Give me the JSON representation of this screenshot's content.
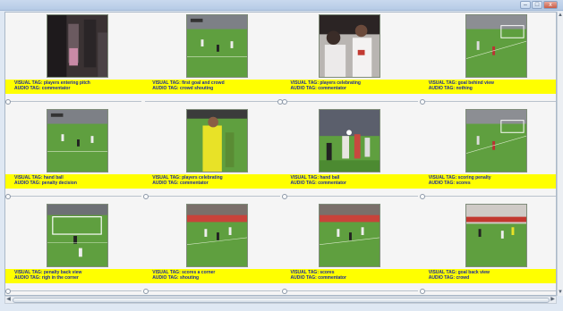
{
  "window": {
    "buttons": [
      {
        "name": "minimize-button",
        "glyph": "–"
      },
      {
        "name": "maximize-button",
        "glyph": "□"
      },
      {
        "name": "close-button",
        "glyph": "x"
      }
    ]
  },
  "clips": [
    {
      "visual": "VISUAL TAG: players entering pitch",
      "audio": "AUDIO TAG: commentator",
      "scene": "tunnel"
    },
    {
      "visual": "VISUAL TAG: first goal and crowd",
      "audio": "AUDIO TAG: crowd shouting",
      "scene": "pitch"
    },
    {
      "visual": "VISUAL TAG: players celebrating",
      "audio": "AUDIO TAG: commentator",
      "scene": "celebrate"
    },
    {
      "visual": "VISUAL TAG: goal behind view",
      "audio": "AUDIO TAG: nothing",
      "scene": "goalview"
    },
    {
      "visual": "VISUAL TAG: hand ball",
      "audio": "AUDIO TAG: penalty decision",
      "scene": "pitch"
    },
    {
      "visual": "VISUAL TAG: players celebrating",
      "audio": "AUDIO TAG: commentator",
      "scene": "referee"
    },
    {
      "visual": "VISUAL TAG: hand ball",
      "audio": "AUDIO TAG: commentator",
      "scene": "handball"
    },
    {
      "visual": "VISUAL TAG: scoring penalty",
      "audio": "AUDIO TAG: scores",
      "scene": "goalview"
    },
    {
      "visual": "VISUAL TAG: penalty back view",
      "audio": "AUDIO TAG: righ in the corner",
      "scene": "penalty"
    },
    {
      "visual": "VISUAL TAG: scores a corner",
      "audio": "AUDIO TAG: shouting",
      "scene": "corner"
    },
    {
      "visual": "VISUAL TAG: scores",
      "audio": "AUDIO TAG: commentator",
      "scene": "corner"
    },
    {
      "visual": "VISUAL TAG: goal back view",
      "audio": "AUDIO TAG: crowd",
      "scene": "stands"
    }
  ],
  "colors": {
    "caption_bg": "#ffff00",
    "caption_text": "#1d2b9a",
    "grass": "#5f9f3f"
  }
}
